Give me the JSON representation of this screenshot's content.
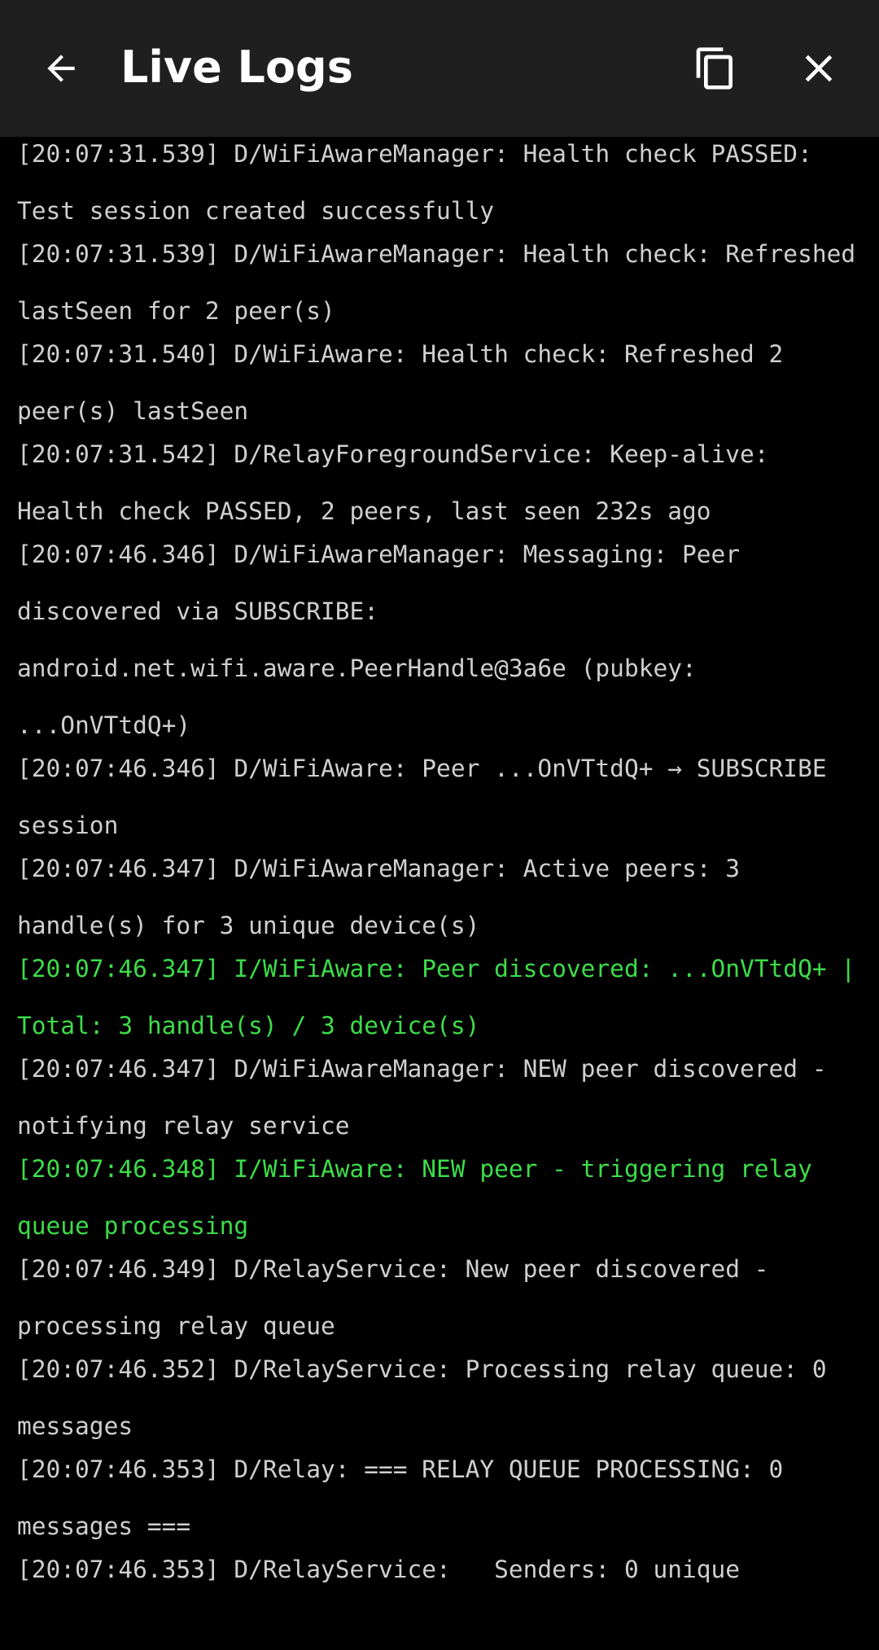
{
  "app_bar": {
    "title": "Live Logs",
    "back_icon": "arrow-left-icon",
    "copy_icon": "copy-icon",
    "close_icon": "close-icon"
  },
  "colors": {
    "app_bar_bg": "#1f1f1f",
    "log_bg": "#000000",
    "debug_text": "#cfcfcf",
    "info_text": "#3ddc4a"
  },
  "logs": [
    {
      "level": "D",
      "text": "[20:07:31.539] D/WiFiAwareManager: Health check PASSED: Test session created successfully"
    },
    {
      "level": "D",
      "text": "[20:07:31.539] D/WiFiAwareManager: Health check: Refreshed lastSeen for 2 peer(s)"
    },
    {
      "level": "D",
      "text": "[20:07:31.540] D/WiFiAware: Health check: Refreshed 2 peer(s) lastSeen"
    },
    {
      "level": "D",
      "text": "[20:07:31.542] D/RelayForegroundService: Keep-alive: Health check PASSED, 2 peers, last seen 232s ago"
    },
    {
      "level": "D",
      "text": "[20:07:46.346] D/WiFiAwareManager: Messaging: Peer discovered via SUBSCRIBE: android.net.wifi.aware.PeerHandle@3a6e (pubkey: ...OnVTtdQ+)"
    },
    {
      "level": "D",
      "text": "[20:07:46.346] D/WiFiAware: Peer ...OnVTtdQ+ → SUBSCRIBE session"
    },
    {
      "level": "D",
      "text": "[20:07:46.347] D/WiFiAwareManager: Active peers: 3 handle(s) for 3 unique device(s)"
    },
    {
      "level": "I",
      "text": "[20:07:46.347] I/WiFiAware: Peer discovered: ...OnVTtdQ+ | Total: 3 handle(s) / 3 device(s)"
    },
    {
      "level": "D",
      "text": "[20:07:46.347] D/WiFiAwareManager: NEW peer discovered - notifying relay service"
    },
    {
      "level": "I",
      "text": "[20:07:46.348] I/WiFiAware: NEW peer - triggering relay queue processing"
    },
    {
      "level": "D",
      "text": "[20:07:46.349] D/RelayService: New peer discovered - processing relay queue"
    },
    {
      "level": "D",
      "text": "[20:07:46.352] D/RelayService: Processing relay queue: 0 messages"
    },
    {
      "level": "D",
      "text": "[20:07:46.353] D/Relay: === RELAY QUEUE PROCESSING: 0 messages ==="
    },
    {
      "level": "D",
      "text": "[20:07:46.353] D/RelayService:   Senders: 0 unique"
    }
  ]
}
